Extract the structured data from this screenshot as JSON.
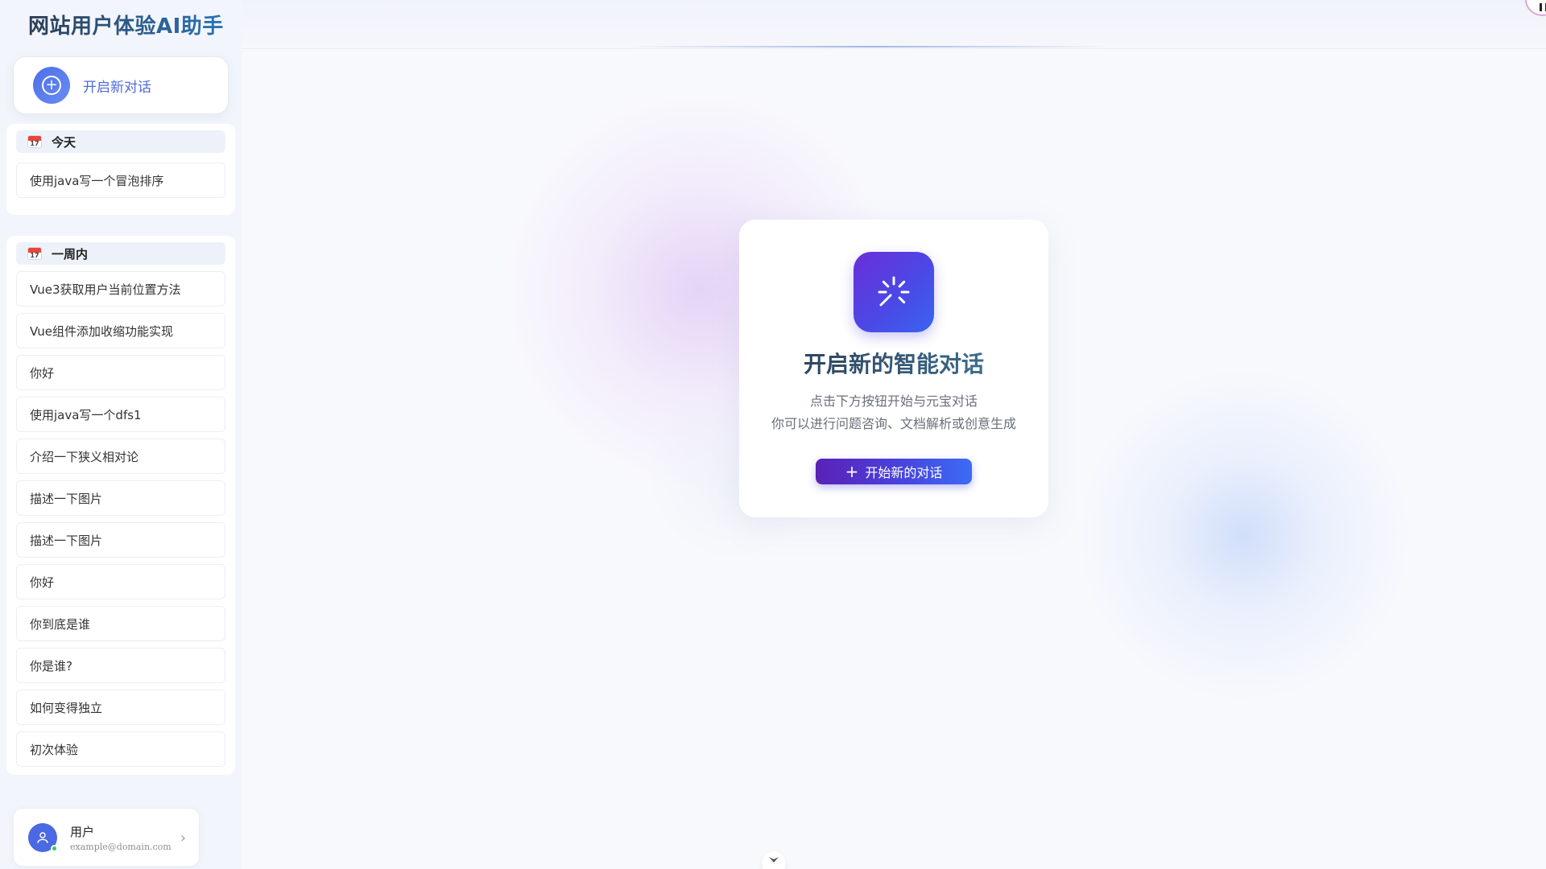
{
  "app": {
    "title": "网站用户体验AI助手"
  },
  "sidebar": {
    "new_chat_label": "开启新对话",
    "groups": [
      {
        "title": "今天",
        "items": [
          "使用java写一个冒泡排序"
        ]
      },
      {
        "title": "一周内",
        "items": [
          "Vue3获取用户当前位置方法",
          "Vue组件添加收缩功能实现",
          "你好",
          "使用java写一个dfs1",
          "介绍一下狭义相对论",
          "描述一下图片",
          "描述一下图片",
          "你好",
          "你到底是谁",
          "你是谁?",
          "如何变得独立",
          "初次体验"
        ]
      }
    ],
    "user": {
      "name": "用户",
      "email": "example@domain.com"
    }
  },
  "welcome": {
    "title": "开启新的智能对话",
    "subtitle_line1": "点击下方按钮开始与元宝对话",
    "subtitle_line2": "你可以进行问题咨询、文档解析或创意生成",
    "button_label": "开始新的对话"
  },
  "colors": {
    "accent": "#4f6bd8",
    "button_gradient_start": "#5b21b6",
    "button_gradient_end": "#3b6cf3",
    "online": "#2ec76b"
  },
  "icons": {
    "new_chat": "plus-circle-icon",
    "group": "calendar-icon",
    "logo": "sparkle-loader-icon",
    "user": "user-icon",
    "chevron": "chevron-right-icon",
    "scroll": "chevron-down-icon"
  }
}
